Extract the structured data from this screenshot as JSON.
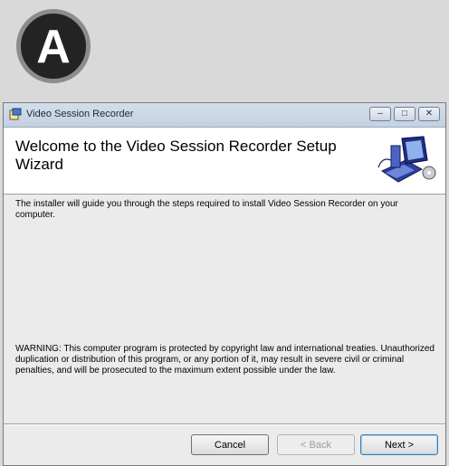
{
  "badge": {
    "letter": "A"
  },
  "window": {
    "title": "Video Session Recorder",
    "controls": {
      "minimize": "–",
      "maximize": "□",
      "close": "✕"
    }
  },
  "header": {
    "title": "Welcome to the Video Session Recorder Setup Wizard",
    "icon": "computer-icon"
  },
  "body": {
    "intro": "The installer will guide you through the steps required to install Video Session Recorder on your computer.",
    "warning": "WARNING: This computer program is protected by copyright law and international treaties. Unauthorized duplication or distribution of this program, or any portion of it, may result in severe civil or criminal penalties, and will be prosecuted to the maximum extent possible under the law."
  },
  "buttons": {
    "cancel": "Cancel",
    "back": "< Back",
    "next": "Next >"
  }
}
